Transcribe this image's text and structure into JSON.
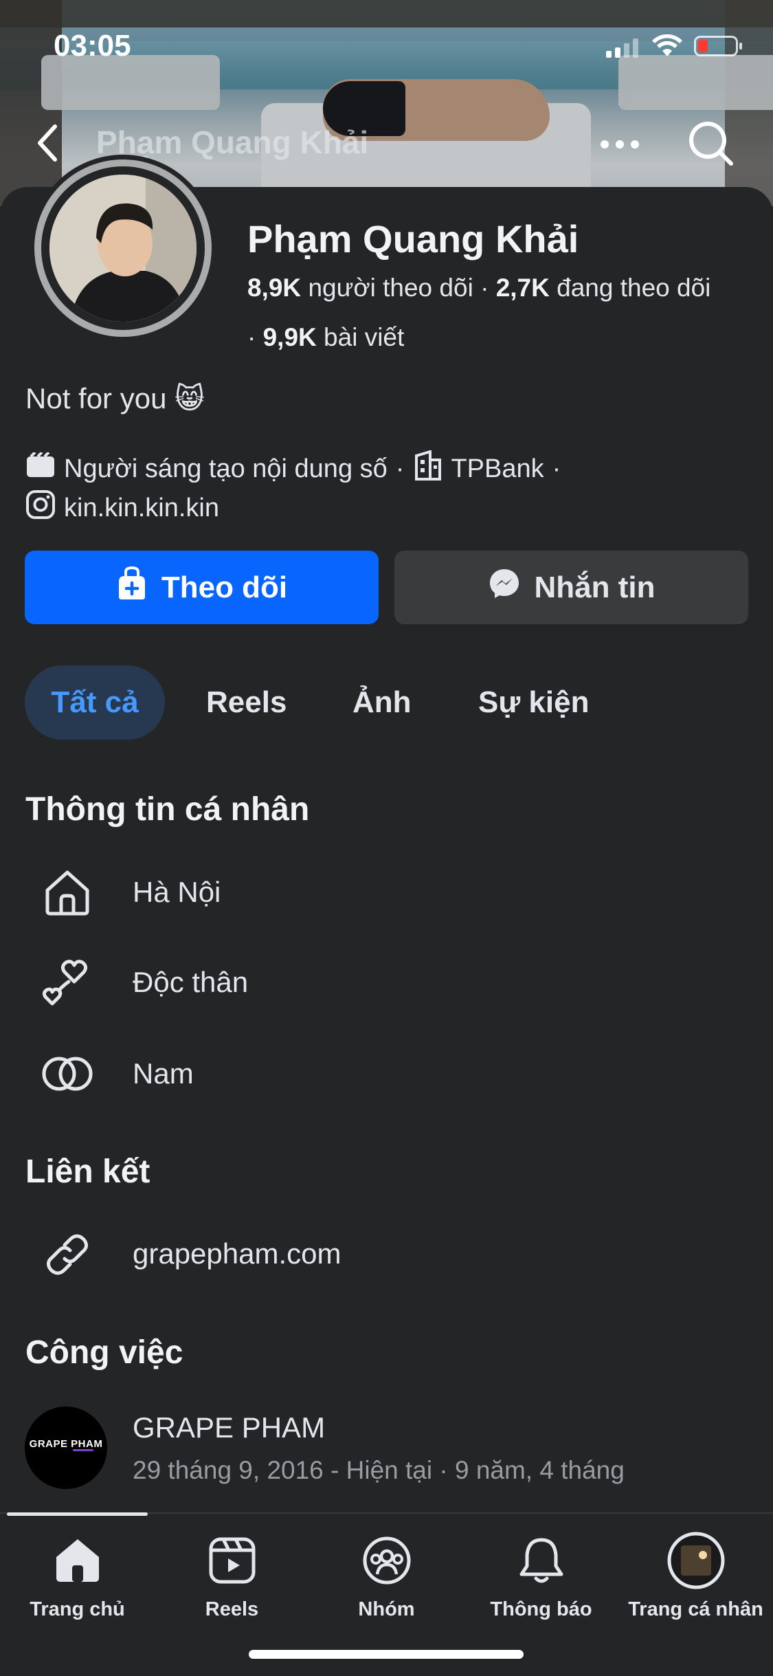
{
  "status_bar": {
    "time": "03:05"
  },
  "header": {
    "title": "Phạm Quang Khải"
  },
  "profile": {
    "name": "Phạm Quang Khải",
    "followers_count": "8,9K",
    "followers_label": "người theo dõi",
    "following_count": "2,7K",
    "following_label": "đang theo dõi",
    "posts_count": "9,9K",
    "posts_label": "bài viết",
    "bio": "Not for you 😸",
    "category": "Người sáng tạo nội dung số",
    "workplace": "TPBank",
    "instagram": "kin.kin.kin.kin"
  },
  "actions": {
    "follow_label": "Theo dõi",
    "message_label": "Nhắn tin"
  },
  "tabs": [
    {
      "label": "Tất cả",
      "active": true
    },
    {
      "label": "Reels"
    },
    {
      "label": "Ảnh"
    },
    {
      "label": "Sự kiện"
    }
  ],
  "personal_info": {
    "heading": "Thông tin cá nhân",
    "items": [
      {
        "icon": "home-icon",
        "text": "Hà Nội"
      },
      {
        "icon": "hearts-icon",
        "text": "Độc thân"
      },
      {
        "icon": "gender-rings-icon",
        "text": "Nam"
      }
    ]
  },
  "links": {
    "heading": "Liên kết",
    "items": [
      {
        "icon": "link-icon",
        "text": "grapepham.com"
      }
    ]
  },
  "work": {
    "heading": "Công việc",
    "company": "GRAPE PHAM",
    "period": "29 tháng 9, 2016 - Hiện tại · 9 năm, 4 tháng",
    "logo_text": "GRAPE PHAM"
  },
  "bottom_nav": [
    {
      "label": "Trang chủ",
      "icon": "home-filled-icon"
    },
    {
      "label": "Reels",
      "icon": "reels-icon"
    },
    {
      "label": "Nhóm",
      "icon": "groups-icon"
    },
    {
      "label": "Thông báo",
      "icon": "bell-icon"
    },
    {
      "label": "Trang cá nhân",
      "icon": "profile-avatar"
    }
  ],
  "colors": {
    "accent": "#0866ff",
    "background": "#242527",
    "button_secondary": "#3a3b3d",
    "active_tab_text": "#4599ff"
  }
}
